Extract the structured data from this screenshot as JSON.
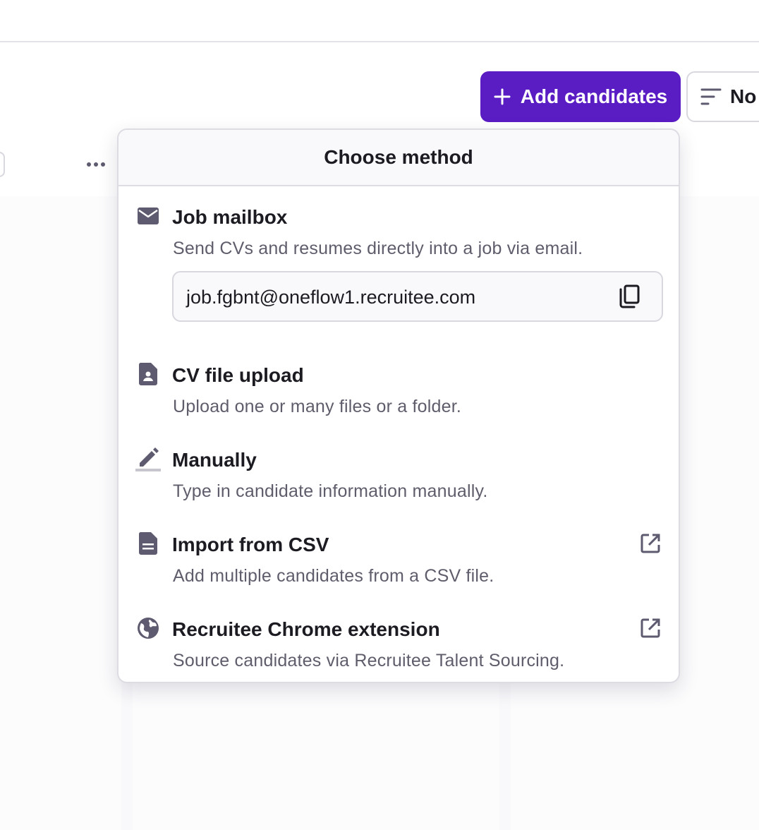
{
  "header": {
    "add_candidates_label": "Add candidates",
    "sort_label": "No"
  },
  "colors": {
    "accent": "#5a1cc3",
    "icon": "#5e5a6f",
    "text_primary": "#1c1b22",
    "text_secondary": "#5f5d6b"
  },
  "popover": {
    "title": "Choose method",
    "methods": [
      {
        "title": "Job mailbox",
        "description": "Send CVs and resumes directly into a job via email.",
        "icon": "mail-icon",
        "email": "job.fgbnt@oneflow1.recruitee.com",
        "copy_icon": "copy-icon"
      },
      {
        "title": "CV file upload",
        "description": "Upload one or many files or a folder.",
        "icon": "file-person-icon"
      },
      {
        "title": "Manually",
        "description": "Type in candidate information manually.",
        "icon": "pencil-icon"
      },
      {
        "title": "Import from CSV",
        "description": "Add multiple candidates from a CSV file.",
        "icon": "document-icon",
        "external_icon": "external-link-icon"
      },
      {
        "title": "Recruitee Chrome extension",
        "description": "Source candidates via Recruitee Talent Sourcing.",
        "icon": "globe-icon",
        "external_icon": "external-link-icon"
      }
    ]
  }
}
